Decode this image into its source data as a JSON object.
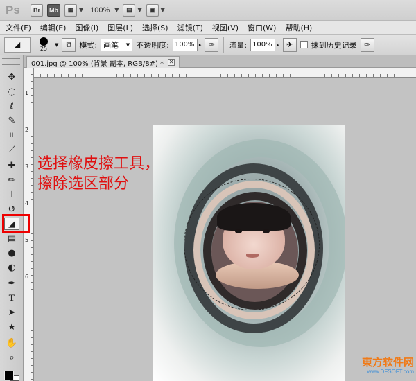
{
  "app": {
    "logo": "Ps",
    "bridge_label": "Br",
    "minibridge_label": "Mb",
    "zoom": "100%"
  },
  "menu": [
    "文件(F)",
    "编辑(E)",
    "图像(I)",
    "图层(L)",
    "选择(S)",
    "滤镜(T)",
    "视图(V)",
    "窗口(W)",
    "帮助(H)"
  ],
  "options": {
    "brush_size": "25",
    "mode_label": "模式:",
    "mode_value": "画笔",
    "opacity_label": "不透明度:",
    "opacity_value": "100%",
    "flow_label": "流量:",
    "flow_value": "100%",
    "history_label": "抹到历史记录"
  },
  "document": {
    "tab_title": "001.jpg @ 100% (背景 副本, RGB/8#) *",
    "close_glyph": "✕"
  },
  "ruler": {
    "v_marks": [
      "1",
      "2",
      "3",
      "4",
      "5",
      "6"
    ]
  },
  "annotation": {
    "text": "选择橡皮擦工具，擦除选区部分",
    "color": "#e01010"
  },
  "watermark": {
    "main": "東方软件网",
    "sub": "www.DFSOFT.com"
  },
  "tools": [
    {
      "name": "move-tool-icon",
      "glyph": "✥"
    },
    {
      "name": "marquee-tool-icon",
      "glyph": "◌"
    },
    {
      "name": "lasso-tool-icon",
      "glyph": "ℓ"
    },
    {
      "name": "quick-selection-tool-icon",
      "glyph": "✎"
    },
    {
      "name": "crop-tool-icon",
      "glyph": "⌗"
    },
    {
      "name": "eyedropper-tool-icon",
      "glyph": "⟋"
    },
    {
      "name": "healing-brush-tool-icon",
      "glyph": "✚"
    },
    {
      "name": "brush-tool-icon",
      "glyph": "✏"
    },
    {
      "name": "clone-stamp-tool-icon",
      "glyph": "⊥"
    },
    {
      "name": "history-brush-tool-icon",
      "glyph": "↺"
    },
    {
      "name": "eraser-tool-icon",
      "glyph": "◢"
    },
    {
      "name": "gradient-tool-icon",
      "glyph": "▤"
    },
    {
      "name": "blur-tool-icon",
      "glyph": "●"
    },
    {
      "name": "dodge-tool-icon",
      "glyph": "◐"
    },
    {
      "name": "pen-tool-icon",
      "glyph": "✒"
    },
    {
      "name": "type-tool-icon",
      "glyph": "T"
    },
    {
      "name": "path-selection-tool-icon",
      "glyph": "➤"
    },
    {
      "name": "shape-tool-icon",
      "glyph": "★"
    },
    {
      "name": "hand-tool-icon",
      "glyph": "✋"
    },
    {
      "name": "zoom-tool-icon",
      "glyph": "⌕"
    }
  ]
}
